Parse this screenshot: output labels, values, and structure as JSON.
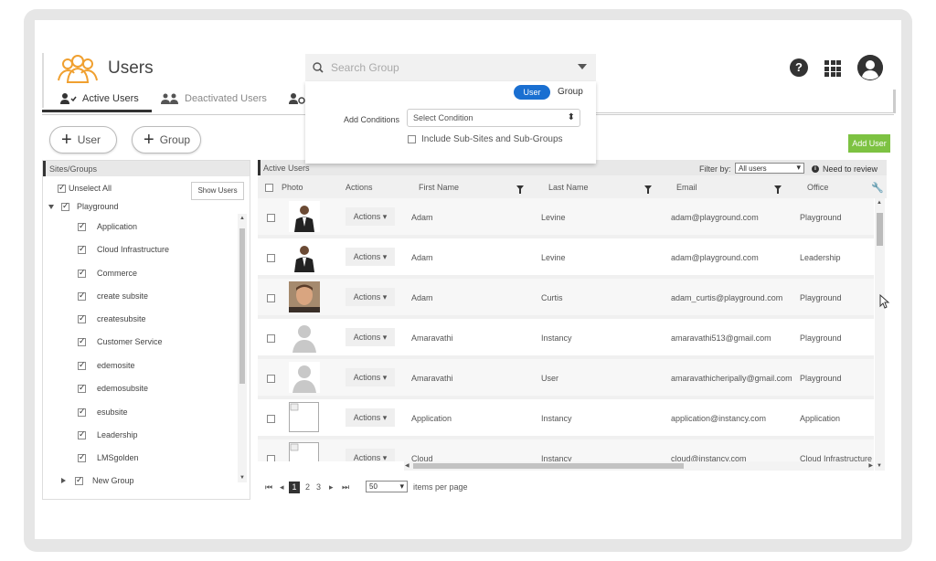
{
  "header": {
    "title": "Users",
    "search_placeholder": "Search Group"
  },
  "tabs": [
    {
      "label": "Active Users",
      "active": true
    },
    {
      "label": "Deactivated Users",
      "active": false
    }
  ],
  "search_panel": {
    "toggle_user": "User",
    "toggle_group": "Group",
    "add_conditions_label": "Add Conditions",
    "condition_placeholder": "Select Condition",
    "include_label": "Include Sub-Sites and Sub-Groups"
  },
  "buttons": {
    "add_user_pill": "User",
    "add_group_pill": "Group",
    "add_user": "Add User",
    "show_users": "Show Users"
  },
  "sites": {
    "header": "Sites/Groups",
    "unselect_all": "Unselect All",
    "root": "Playground",
    "items": [
      "Application",
      "Cloud Infrastructure",
      "Commerce",
      "create subsite",
      "createsubsite",
      "Customer Service",
      "edemosite",
      "edemosubsite",
      "esubsite",
      "Leadership",
      "LMSgolden"
    ],
    "next_root": "New Group"
  },
  "grid": {
    "header": "Active Users",
    "filter_label": "Filter by:",
    "filter_value": "All users",
    "need_review": "Need to review",
    "columns": {
      "photo": "Photo",
      "actions": "Actions",
      "first_name": "First Name",
      "last_name": "Last Name",
      "email": "Email",
      "office": "Office"
    },
    "rows": [
      {
        "actions": "Actions",
        "first": "Adam",
        "last": "Levine",
        "email": "adam@playground.com",
        "office": "Playground",
        "photo": "suit"
      },
      {
        "actions": "Actions",
        "first": "Adam",
        "last": "Levine",
        "email": "adam@playground.com",
        "office": "Leadership",
        "photo": "suit"
      },
      {
        "actions": "Actions",
        "first": "Adam",
        "last": "Curtis",
        "email": "adam_curtis@playground.com",
        "office": "Playground",
        "photo": "face"
      },
      {
        "actions": "Actions",
        "first": "Amaravathi",
        "last": "Instancy",
        "email": "amaravathi513@gmail.com",
        "office": "Playground",
        "photo": "silhouette"
      },
      {
        "actions": "Actions",
        "first": "Amaravathi",
        "last": "User",
        "email": "amaravathicheripally@gmail.com",
        "office": "Playground",
        "photo": "silhouette"
      },
      {
        "actions": "Actions",
        "first": "Application",
        "last": "Instancy",
        "email": "application@instancy.com",
        "office": "Application",
        "photo": "broken"
      },
      {
        "actions": "Actions",
        "first": "Cloud",
        "last": "Instancy",
        "email": "cloud@instancy.com",
        "office": "Cloud Infrastructure",
        "photo": "broken"
      }
    ]
  },
  "pager": {
    "pages": [
      "1",
      "2",
      "3"
    ],
    "current": "1",
    "per_page": "50",
    "per_page_label": "items per page"
  },
  "colors": {
    "accent_blue": "#1a6fd1",
    "add_user_green": "#7dc242",
    "users_icon_orange": "#f0a030"
  },
  "icons": [
    "users-icon",
    "active-user-icon",
    "deactivated-users-icon",
    "settings-user-icon",
    "search-icon",
    "help-icon",
    "apps-grid-icon",
    "profile-icon",
    "plus-icon",
    "filter-icon",
    "info-icon",
    "wrench-icon",
    "mouse-cursor-icon"
  ]
}
